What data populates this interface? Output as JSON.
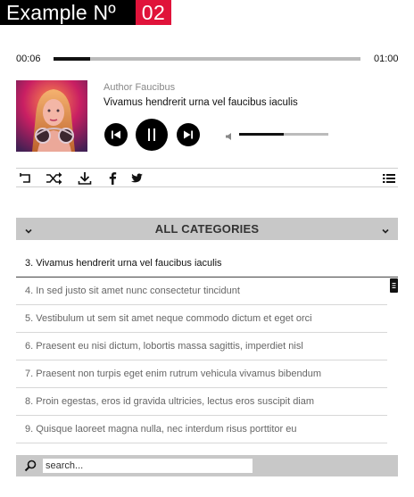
{
  "header": {
    "title": "Example Nº",
    "number": "02"
  },
  "player": {
    "elapsed": "00:06",
    "duration": "01:00",
    "progress_fraction": 0.12,
    "author": "Author Faucibus",
    "track_title": "Vivamus hendrerit urna vel faucibus iaculis",
    "state": "playing",
    "volume_fraction": 0.5
  },
  "toolbar": {
    "icons": [
      "repeat-icon",
      "shuffle-icon",
      "download-icon",
      "facebook-icon",
      "twitter-icon",
      "playlist-icon"
    ]
  },
  "categories": {
    "label": "ALL CATEGORIES"
  },
  "playlist": {
    "items": [
      {
        "label": "3. Vivamus hendrerit urna vel faucibus iaculis",
        "active": true
      },
      {
        "label": "4. In sed justo sit amet nunc consectetur tincidunt",
        "active": false
      },
      {
        "label": "5. Vestibulum ut sem sit amet neque commodo dictum et eget orci",
        "active": false
      },
      {
        "label": "6. Praesent eu nisi dictum, lobortis massa sagittis, imperdiet nisl",
        "active": false
      },
      {
        "label": "7. Praesent non turpis eget enim rutrum vehicula vivamus bibendum",
        "active": false
      },
      {
        "label": "8. Proin egestas, eros id gravida ultricies, lectus eros suscipit diam",
        "active": false
      },
      {
        "label": "9. Quisque laoreet magna nulla, nec interdum risus porttitor eu",
        "active": false
      }
    ]
  },
  "search": {
    "placeholder": "search..."
  },
  "colors": {
    "accent": "#e0133a",
    "dark": "#000000",
    "bar": "#c8c8c8"
  }
}
